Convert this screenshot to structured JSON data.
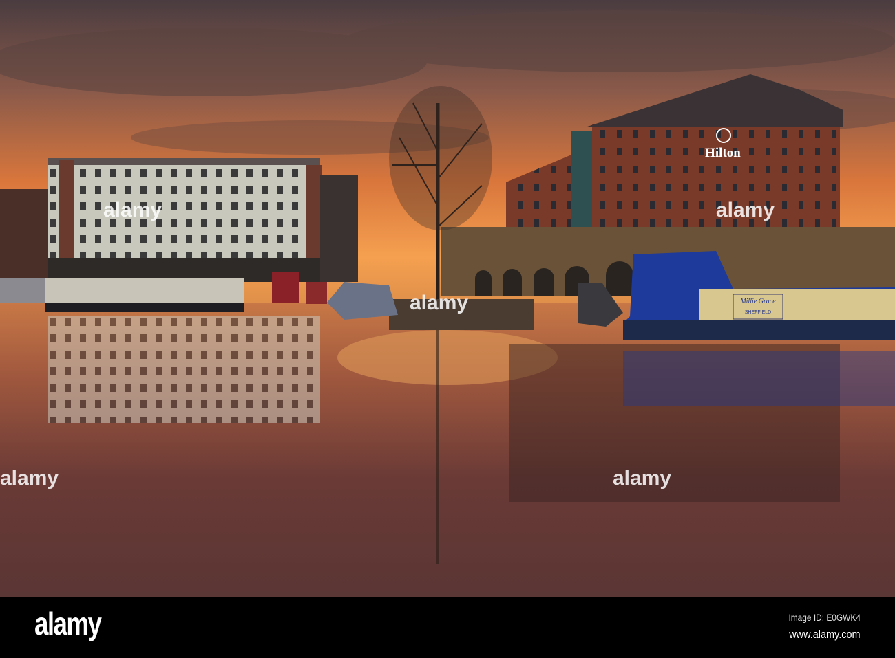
{
  "photo": {
    "hotel_sign": "Hilton",
    "boat_name": "Millie Grace",
    "boat_home": "Sheffield"
  },
  "watermark": {
    "logo": "alamy"
  },
  "footer": {
    "logo": "alamy",
    "image_id": "Image ID: E0GWK4",
    "url": "www.alamy.com"
  },
  "colors": {
    "sky_glow": "#f08a3a",
    "sky_dark": "#4a3a3c",
    "water": "#6a3a36",
    "footer": "#000000"
  }
}
